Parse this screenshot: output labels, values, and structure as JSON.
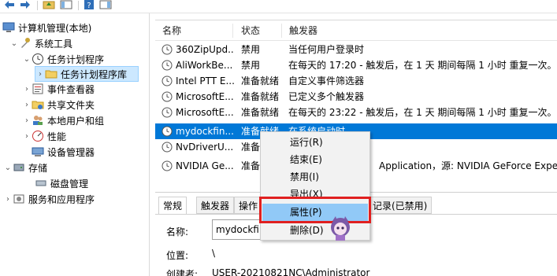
{
  "colors": {
    "selection": "#0078d7",
    "tree_selected": "#cce8ff",
    "menu_hover": "#91c9f7",
    "highlight_box": "#e02020"
  },
  "tree": {
    "items": [
      {
        "label": "计算机管理(本地)",
        "icon": "computer-management-icon"
      },
      {
        "label": "系统工具",
        "icon": "tools-icon"
      },
      {
        "label": "任务计划程序",
        "icon": "clock-icon"
      },
      {
        "label": "任务计划程序库",
        "icon": "folder-icon"
      },
      {
        "label": "事件查看器",
        "icon": "event-viewer-icon"
      },
      {
        "label": "共享文件夹",
        "icon": "shared-folder-icon"
      },
      {
        "label": "本地用户和组",
        "icon": "users-icon"
      },
      {
        "label": "性能",
        "icon": "performance-icon"
      },
      {
        "label": "设备管理器",
        "icon": "device-manager-icon"
      },
      {
        "label": "存储",
        "icon": "storage-icon"
      },
      {
        "label": "磁盘管理",
        "icon": "disk-icon"
      },
      {
        "label": "服务和应用程序",
        "icon": "services-icon"
      }
    ]
  },
  "list": {
    "columns": [
      "名称",
      "状态",
      "触发器"
    ],
    "rows": [
      {
        "name": "360ZipUpd...",
        "status": "禁用",
        "trigger": "当任何用户登录时"
      },
      {
        "name": "AliWorkBe...",
        "status": "禁用",
        "trigger": "在每天的 17:20 - 触发后，在 1 天 期间每隔 1 小时 重复一次。"
      },
      {
        "name": "Intel PTT E...",
        "status": "准备就绪",
        "trigger": "自定义事件筛选器"
      },
      {
        "name": "MicrosoftE...",
        "status": "准备就绪",
        "trigger": "已定义多个触发器"
      },
      {
        "name": "MicrosoftE...",
        "status": "准备就绪",
        "trigger": "在每天的 23:22 - 触发后，在 1 天 期间每隔 1 小时 重复一次。"
      },
      {
        "name": "mydockfin...",
        "status": "准备就绪",
        "trigger": "在系统启动时"
      },
      {
        "name": "NvDriverU...",
        "status": "准备就绪",
        "trigger": ""
      },
      {
        "name": "NVIDIA Ge...",
        "status": "准备就绪",
        "trigger": "Application，源: NVIDIA GeForce Experie"
      }
    ]
  },
  "details": {
    "tabs": [
      "常规",
      "触发器",
      "操作",
      "记录(已禁用)"
    ],
    "name_label": "名称:",
    "name_value": "mydockfin",
    "location_label": "位置:",
    "location_value": "\\",
    "author_label": "创建者:",
    "author_value": "USER-20210821NC\\Administrator"
  },
  "context_menu": {
    "items": [
      "运行(R)",
      "结束(E)",
      "禁用(I)",
      "导出(X)",
      "属性(P)",
      "删除(D)"
    ]
  }
}
